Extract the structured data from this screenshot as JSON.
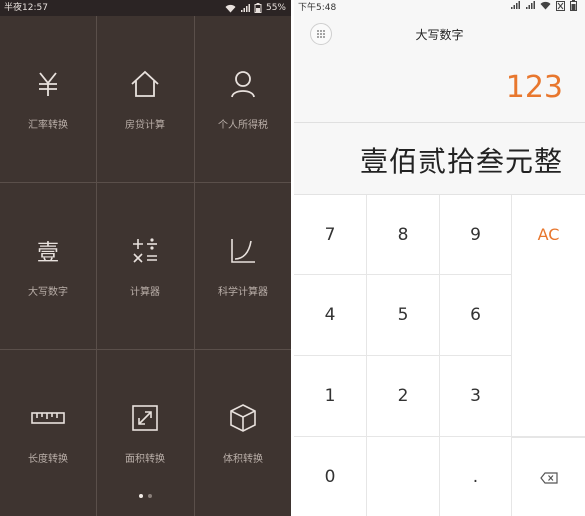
{
  "left": {
    "status": {
      "time": "半夜12:57",
      "battery": "55%"
    },
    "tiles": [
      {
        "label": "汇率转换",
        "icon": "yen-icon"
      },
      {
        "label": "房贷计算",
        "icon": "house-icon"
      },
      {
        "label": "个人所得税",
        "icon": "person-icon"
      },
      {
        "label": "大写数字",
        "icon": "capital-numeral-icon",
        "glyph": "壹"
      },
      {
        "label": "计算器",
        "icon": "calculator-icon"
      },
      {
        "label": "科学计算器",
        "icon": "scientific-graph-icon"
      },
      {
        "label": "长度转换",
        "icon": "ruler-icon"
      },
      {
        "label": "面积转换",
        "icon": "area-icon"
      },
      {
        "label": "体积转换",
        "icon": "cube-icon"
      }
    ],
    "pages": {
      "count": 2,
      "active": 0
    }
  },
  "right": {
    "status": {
      "time": "下午5:48"
    },
    "title": "大写数字",
    "input": "123",
    "result": "壹佰贰拾叁元整",
    "keys": {
      "k7": "7",
      "k8": "8",
      "k9": "9",
      "ac": "AC",
      "k4": "4",
      "k5": "5",
      "k6": "6",
      "k1": "1",
      "k2": "2",
      "k3": "3",
      "k0": "0",
      "dot": "."
    },
    "accent": "#e8772e"
  }
}
